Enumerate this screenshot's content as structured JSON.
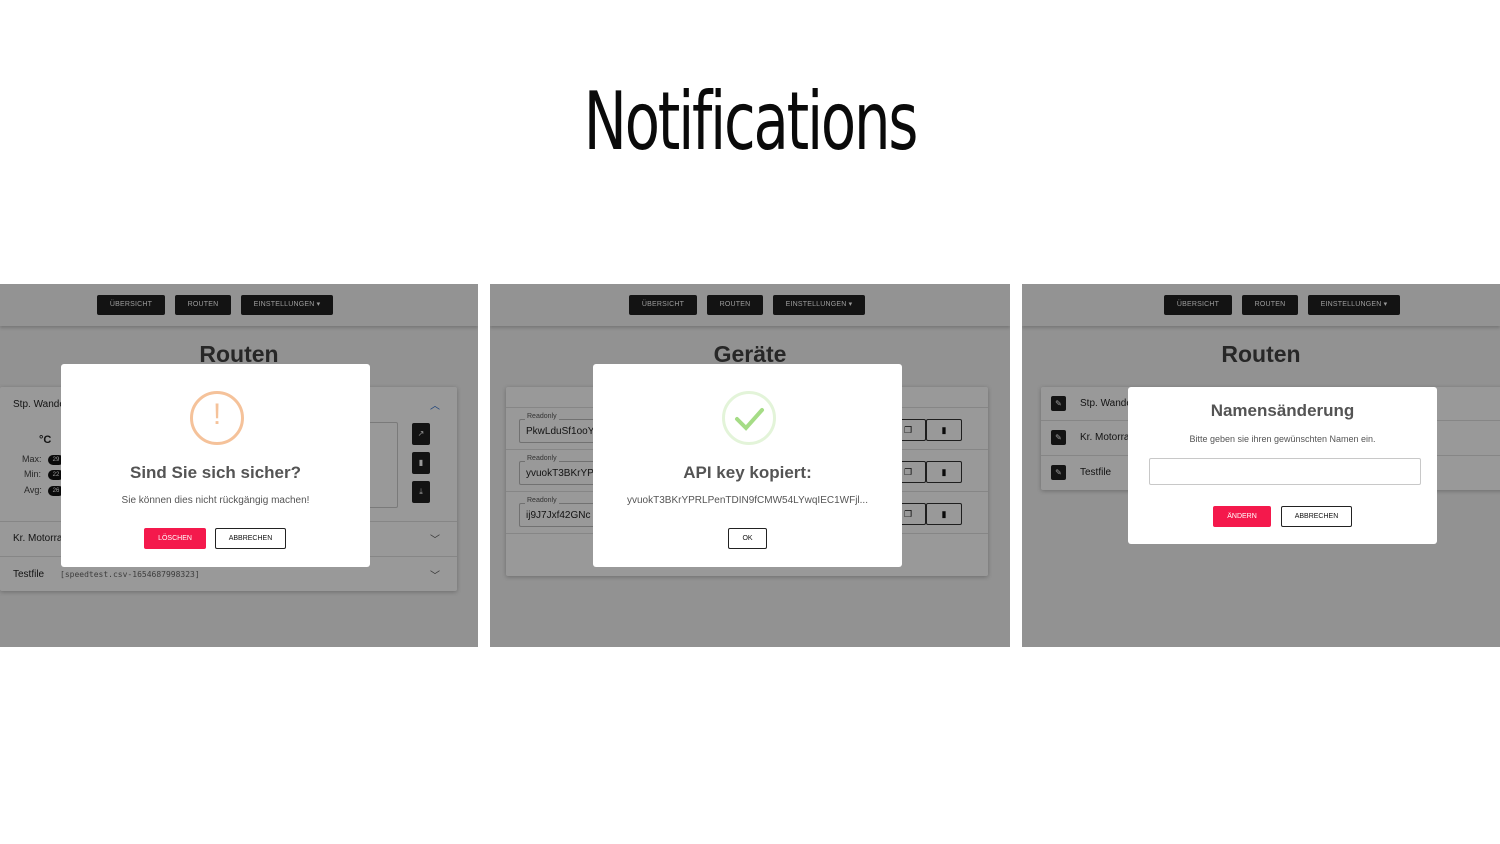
{
  "page": {
    "title": "Notifications"
  },
  "nav": {
    "overview": "ÜBERSICHT",
    "routes": "ROUTEN",
    "settings": "EINSTELLUNGEN ▾"
  },
  "panel1": {
    "heading": "Routen",
    "routes": [
      {
        "label": "Stp. Wande"
      },
      {
        "label": "Kr. Motorra"
      },
      {
        "label": "Testfile",
        "file": "[speedtest.csv-1654687998323]"
      }
    ],
    "temp_unit": "°C",
    "stats": {
      "max_label": "Max:",
      "min_label": "Min:",
      "avg_label": "Avg:",
      "max": "29",
      "min": "22",
      "avg": "26"
    },
    "dialog": {
      "icon_glyph": "!",
      "title": "Sind Sie sich sicher?",
      "text": "Sie können dies nicht rückgängig machen!",
      "confirm": "LÖSCHEN",
      "cancel": "ABBRECHEN"
    }
  },
  "panel2": {
    "heading": "Geräte",
    "keys": [
      {
        "label": "Readonly",
        "value": "PkwLduSf1ooY"
      },
      {
        "label": "Readonly",
        "value": "yvuokT3BKrYPF"
      },
      {
        "label": "Readonly",
        "value": "ij9J7Jxf42GNc"
      }
    ],
    "dialog": {
      "title": "API key kopiert:",
      "text": "yvuokT3BKrYPRLPenTDIN9fCMW54LYwqIEC1WFjl...",
      "ok": "OK"
    }
  },
  "panel3": {
    "heading": "Routen",
    "routes": [
      {
        "label": "Stp. Wande"
      },
      {
        "label": "Kr. Motorra"
      },
      {
        "label": "Testfile"
      }
    ],
    "dialog": {
      "title": "Namensänderung",
      "text": "Bitte geben sie ihren gewünschten Namen ein.",
      "input_value": "",
      "confirm": "ÄNDERN",
      "cancel": "ABBRECHEN"
    }
  },
  "colors": {
    "accent": "#f4194c",
    "warning": "#f5c29a",
    "success": "#a5dc86",
    "dark": "#212121"
  }
}
